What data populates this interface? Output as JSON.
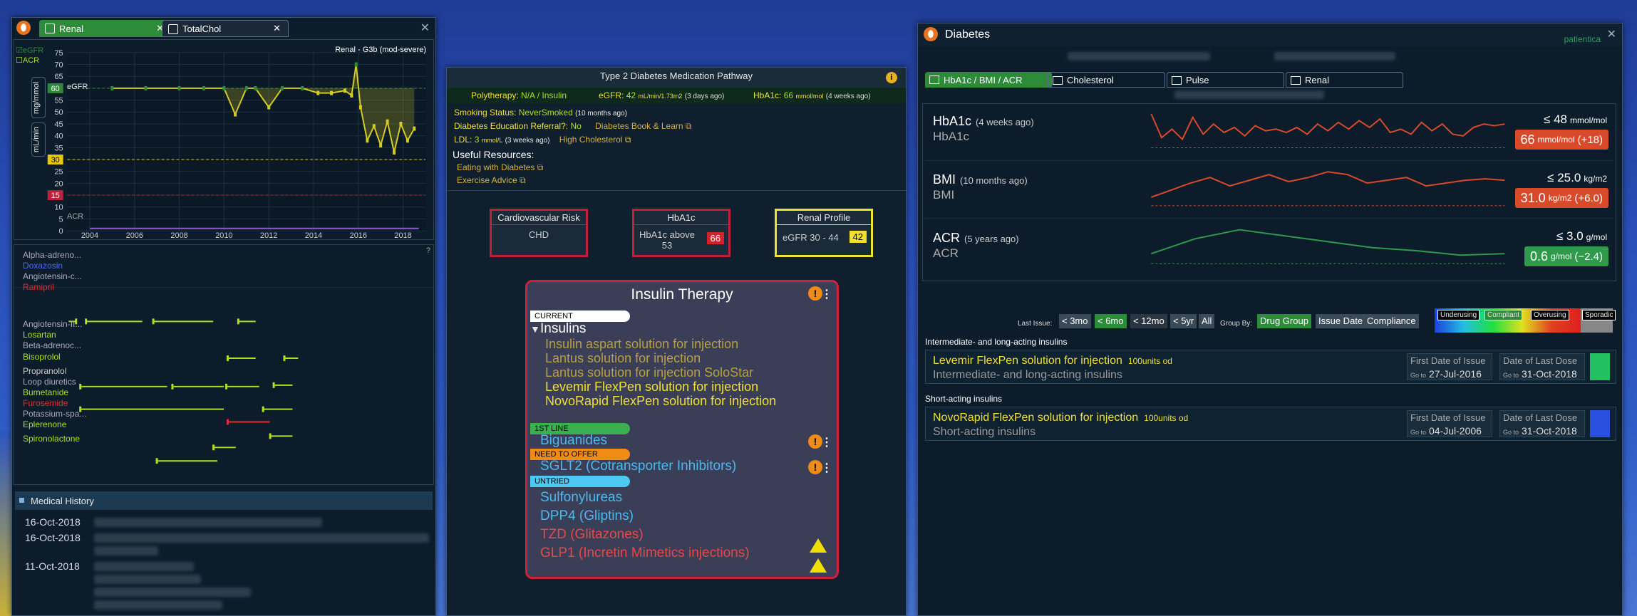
{
  "left_window": {
    "tabs": [
      {
        "label": "Renal"
      },
      {
        "label": "TotalChol"
      }
    ],
    "chart_data": {
      "type": "line",
      "title": "Renal - G3b (mod-severe)",
      "ylabels": [
        "75",
        "70",
        "65",
        "60",
        "55",
        "50",
        "45",
        "40",
        "35",
        "30",
        "25",
        "20",
        "15",
        "10",
        "5",
        "0"
      ],
      "xlabels": [
        "2004",
        "2006",
        "2008",
        "2010",
        "2012",
        "2014",
        "2016",
        "2018"
      ],
      "xlim": [
        2003,
        2019
      ],
      "ylim": [
        0,
        75
      ],
      "y_axis_units": [
        "mL/min",
        "mg/mmol"
      ],
      "thresholds": [
        {
          "value": 60,
          "label": "60",
          "color": "#2e8b3a"
        },
        {
          "value": 30,
          "label": "30",
          "color": "#e8c800"
        },
        {
          "value": 15,
          "label": "15",
          "color": "#c0213a"
        }
      ],
      "legend": [
        "eGFR",
        "ACR"
      ],
      "series": [
        {
          "name": "eGFR",
          "color": "#d4cc22",
          "x": [
            2005.0,
            2006.5,
            2008.0,
            2009.1,
            2010.0,
            2010.5,
            2011.0,
            2011.4,
            2012.0,
            2012.6,
            2013.5,
            2014.2,
            2014.8,
            2015.4,
            2015.7,
            2015.9,
            2016.1,
            2016.4,
            2016.7,
            2017.0,
            2017.3,
            2017.6,
            2017.9,
            2018.2,
            2018.5
          ],
          "y": [
            60,
            60,
            60,
            60,
            60,
            49,
            60,
            60,
            52,
            60,
            60,
            58,
            58,
            59,
            57,
            70,
            52,
            38,
            44,
            36,
            46,
            33,
            45,
            38,
            43
          ]
        },
        {
          "name": "ACR",
          "color": "#8a5ccf",
          "x": [
            2004,
            2018.7
          ],
          "y": [
            1,
            1
          ]
        }
      ],
      "series_labels": {
        "egfr": "eGFR",
        "acr": "ACR"
      }
    },
    "med_rows": [
      {
        "label": "Alpha-adreno...",
        "color": "#aab"
      },
      {
        "label": "Doxazosin",
        "color": "#4a6cf0"
      },
      {
        "label": "Angiotensin-c...",
        "color": "#aab"
      },
      {
        "label": "Ramipril",
        "color": "#e03030"
      },
      {
        "label": "Angiotensin-II...",
        "color": "#aab"
      },
      {
        "label": "Losartan",
        "color": "#b0e020"
      },
      {
        "label": "Beta-adrenoc...",
        "color": "#aab"
      },
      {
        "label": "Bisoprolol",
        "color": "#b0e020"
      },
      {
        "label": "Propranolol",
        "color": "#ccc"
      },
      {
        "label": "Loop diuretics",
        "color": "#aab"
      },
      {
        "label": "Bumetanide",
        "color": "#b0e020"
      },
      {
        "label": "Furosemide",
        "color": "#e03030"
      },
      {
        "label": "Potassium-spa...",
        "color": "#aab"
      },
      {
        "label": "Eplerenone",
        "color": "#b0e020"
      },
      {
        "label": "Spironolactone",
        "color": "#b0e020"
      }
    ],
    "history": {
      "title": "Medical History",
      "dates": [
        "16-Oct-2018",
        "16-Oct-2018",
        "11-Oct-2018"
      ]
    }
  },
  "middle_window": {
    "title": "Type 2 Diabetes Medication Pathway",
    "polytherapy": {
      "label": "Polytherapy:",
      "value": "N/A / Insulin"
    },
    "egfr": {
      "label": "eGFR:",
      "value": "42",
      "unit": "mL/min/1.73m2",
      "age": "(3 days ago)"
    },
    "hba1c": {
      "label": "HbA1c:",
      "value": "66",
      "unit": "mmol/mol",
      "age": "(4 weeks ago)"
    },
    "smoking": {
      "label": "Smoking Status:",
      "value": "NeverSmoked",
      "age": "(10 months ago)"
    },
    "education": {
      "label": "Diabetes Education Referral?:",
      "value": "No",
      "link": "Diabetes Book & Learn"
    },
    "ldl": {
      "label": "LDL:",
      "value": "3",
      "unit": "mmol/L",
      "age": "(3 weeks ago)",
      "link": "High Cholesterol"
    },
    "resources": {
      "title": "Useful Resources:",
      "items": [
        "Eating with Diabetes",
        "Exercise Advice"
      ]
    },
    "risk_boxes": [
      {
        "title": "Cardiovascular Risk",
        "body": "CHD"
      },
      {
        "title": "HbA1c",
        "body": "HbA1c above 53",
        "badge": "66"
      },
      {
        "title": "Renal Profile",
        "body": "eGFR 30 - 44",
        "badge": "42"
      }
    ],
    "insulin": {
      "title": "Insulin Therapy",
      "current_label": "CURRENT",
      "group": "Insulins",
      "items": [
        {
          "name": "Insulin aspart solution for injection",
          "active": false
        },
        {
          "name": "Lantus solution for injection",
          "active": false
        },
        {
          "name": "Lantus solution for injection SoloStar",
          "active": false
        },
        {
          "name": "Levemir FlexPen solution for injection",
          "active": true
        },
        {
          "name": "NovoRapid FlexPen solution for injection",
          "active": true
        }
      ],
      "first_line_label": "1ST LINE",
      "first_line": "Biguanides",
      "need_label": "NEED TO OFFER",
      "need": "SGLT2 (Cotransporter Inhibitors)",
      "untried_label": "UNTRIED",
      "untried": [
        {
          "name": "Sulfonylureas",
          "color": "#4db8f0"
        },
        {
          "name": "DPP4 (Gliptins)",
          "color": "#4db8f0"
        },
        {
          "name": "TZD (Glitazones)",
          "color": "#e84848"
        },
        {
          "name": "GLP1 (Incretin Mimetics injections)",
          "color": "#e84848"
        }
      ]
    }
  },
  "right_window": {
    "title": "Diabetes",
    "brand": "patientica",
    "tabs": [
      "HbA1c / BMI / ACR",
      "Cholesterol",
      "Pulse",
      "Renal"
    ],
    "metrics": [
      {
        "name": "HbA1c",
        "age": "(4 weeks ago)",
        "sub": "HbA1c",
        "target": "≤ 48",
        "target_unit": "mmol/mol",
        "value": "66",
        "unit": "mmol/mol",
        "delta": "(+18)",
        "color": "#d84a2a",
        "x": [
          0,
          1,
          2,
          3,
          4,
          5,
          6,
          7,
          8,
          9,
          10,
          11,
          12,
          13,
          14,
          15,
          16,
          17,
          18,
          19,
          20,
          21,
          22,
          23,
          24,
          25,
          26,
          27,
          28,
          29,
          30,
          31,
          32,
          33,
          34
        ],
        "y": [
          72,
          58,
          63,
          57,
          70,
          60,
          66,
          61,
          64,
          59,
          65,
          62,
          63,
          61,
          64,
          60,
          66,
          62,
          67,
          63,
          68,
          64,
          69,
          61,
          63,
          60,
          67,
          62,
          66,
          60,
          59,
          64,
          66,
          65,
          66
        ]
      },
      {
        "name": "BMI",
        "age": "(10 months ago)",
        "sub": "BMI",
        "target": "≤ 25.0",
        "target_unit": "kg/m2",
        "value": "31.0",
        "unit": "kg/m2",
        "delta": "(+6.0)",
        "color": "#d84a2a",
        "x": [
          0,
          1,
          2,
          3,
          4,
          5,
          6,
          7,
          8,
          9,
          10,
          11,
          12,
          13,
          14,
          15,
          16,
          17,
          18
        ],
        "y": [
          29.8,
          30.3,
          30.8,
          31.2,
          30.6,
          31.0,
          31.4,
          30.9,
          31.2,
          31.6,
          31.4,
          30.8,
          31.0,
          31.2,
          30.6,
          30.8,
          31.0,
          31.1,
          31.0
        ]
      },
      {
        "name": "ACR",
        "age": "(5 years ago)",
        "sub": "ACR",
        "target": "≤ 3.0",
        "target_unit": "g/mol",
        "value": "0.6",
        "unit": "g/mol",
        "delta": "(−2.4)",
        "color": "#2e9a4a",
        "x": [
          0,
          1,
          2,
          3,
          4,
          5,
          6,
          7,
          8
        ],
        "y": [
          0.6,
          1.6,
          2.2,
          1.8,
          1.4,
          1.0,
          0.8,
          0.5,
          0.6
        ]
      }
    ],
    "filter": {
      "last_issue": "Last Issue:",
      "ranges": [
        "< 3mo",
        "< 6mo",
        "< 12mo",
        "< 5yr",
        "All"
      ],
      "group_by": "Group By:",
      "groups": [
        "Drug Group",
        "Issue Date",
        "Compliance"
      ],
      "legend": [
        "Underusing",
        "Compliant",
        "Overusing",
        "Sporadic"
      ]
    },
    "drug_groups": [
      {
        "heading": "Intermediate- and long-acting insulins",
        "name": "Levemir FlexPen solution for injection",
        "dose": "100units od",
        "cls": "Intermediate- and long-acting insulins",
        "first_label": "First Date of Issue",
        "first_go": "Go to",
        "first_date": "27-Jul-2016",
        "last_label": "Date of Last Dose",
        "last_go": "Go to",
        "last_date": "31-Oct-2018",
        "bar": "#22c060"
      },
      {
        "heading": "Short-acting insulins",
        "name": "NovoRapid FlexPen solution for injection",
        "dose": "100units od",
        "cls": "Short-acting insulins",
        "first_label": "First Date of Issue",
        "first_go": "Go to",
        "first_date": "04-Jul-2006",
        "last_label": "Date of Last Dose",
        "last_go": "Go to",
        "last_date": "31-Oct-2018",
        "bar": "#2a50e0"
      }
    ]
  }
}
